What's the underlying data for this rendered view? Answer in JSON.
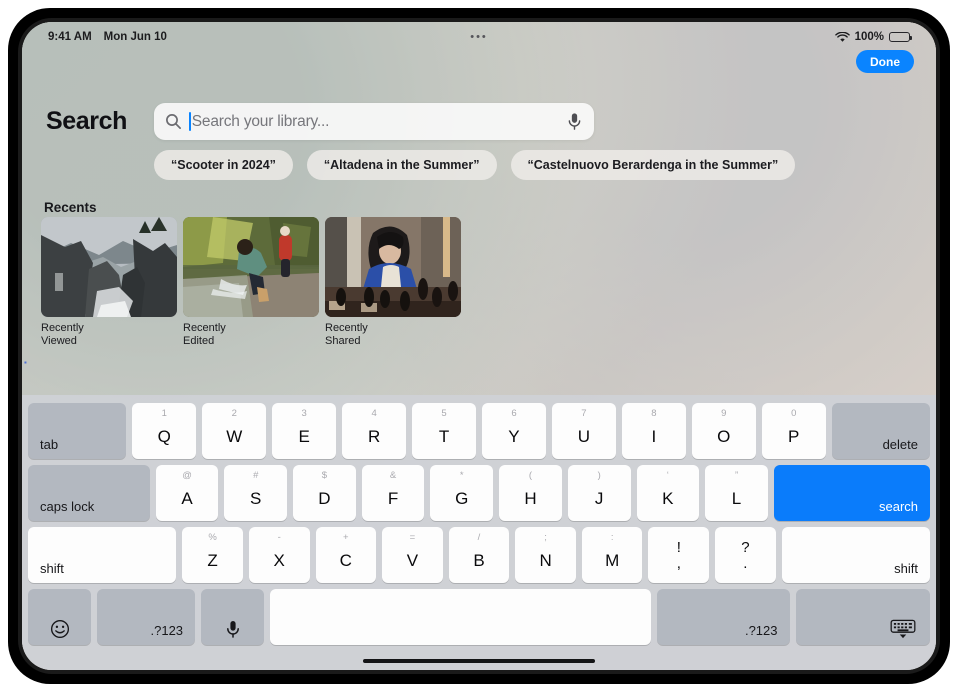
{
  "status_bar": {
    "time": "9:41 AM",
    "date": "Mon Jun 10",
    "battery_percent": "100%",
    "wifi_icon": "wifi-icon",
    "battery_icon": "battery-full-icon",
    "dynamic_island_dots": "•••"
  },
  "header": {
    "title": "Search",
    "done_label": "Done"
  },
  "search": {
    "placeholder": "Search your library...",
    "value": "",
    "search_icon": "search-icon",
    "mic_icon": "microphone-icon",
    "caret_color": "#0a84ff"
  },
  "suggestions": [
    {
      "label": "“Scooter in 2024”"
    },
    {
      "label": "“Altadena in the Summer”"
    },
    {
      "label": "“Castelnuovo Berardenga in the Summer”"
    }
  ],
  "recents": {
    "title": "Recents",
    "items": [
      {
        "label": "Recently Viewed",
        "description": "rocky coastal cove with cliffs and sea"
      },
      {
        "label": "Recently Edited",
        "description": "child splashing in a green creek"
      },
      {
        "label": "Recently Shared",
        "description": "person in blue shirt playing chess"
      }
    ]
  },
  "keyboard": {
    "row1": [
      {
        "main": "tab",
        "type": "mod"
      },
      {
        "main": "Q",
        "hint": "1"
      },
      {
        "main": "W",
        "hint": "2"
      },
      {
        "main": "E",
        "hint": "3"
      },
      {
        "main": "R",
        "hint": "4"
      },
      {
        "main": "T",
        "hint": "5"
      },
      {
        "main": "Y",
        "hint": "6"
      },
      {
        "main": "U",
        "hint": "7"
      },
      {
        "main": "I",
        "hint": "8"
      },
      {
        "main": "O",
        "hint": "9"
      },
      {
        "main": "P",
        "hint": "0"
      },
      {
        "main": "delete",
        "type": "mod-right"
      }
    ],
    "row2": [
      {
        "main": "caps lock",
        "type": "mod"
      },
      {
        "main": "A",
        "hint": "@"
      },
      {
        "main": "S",
        "hint": "#"
      },
      {
        "main": "D",
        "hint": "$"
      },
      {
        "main": "F",
        "hint": "&"
      },
      {
        "main": "G",
        "hint": "*"
      },
      {
        "main": "H",
        "hint": "("
      },
      {
        "main": "J",
        "hint": ")"
      },
      {
        "main": "K",
        "hint": "‘"
      },
      {
        "main": "L",
        "hint": "”"
      },
      {
        "main": "search",
        "type": "blue"
      }
    ],
    "row3": [
      {
        "main": "shift",
        "type": "light-mod"
      },
      {
        "main": "Z",
        "hint": "%"
      },
      {
        "main": "X",
        "hint": "-"
      },
      {
        "main": "C",
        "hint": "+"
      },
      {
        "main": "V",
        "hint": "="
      },
      {
        "main": "B",
        "hint": "/"
      },
      {
        "main": "N",
        "hint": ";"
      },
      {
        "main": "M",
        "hint": ":"
      },
      {
        "top": "!",
        "bottom": ",",
        "type": "dual"
      },
      {
        "top": "?",
        "bottom": ".",
        "type": "dual"
      },
      {
        "main": "shift",
        "type": "light-mod-right"
      }
    ],
    "row4": [
      {
        "icon": "emoji-smiley-icon",
        "type": "icon-left"
      },
      {
        "main": ".?123",
        "type": "mod-center"
      },
      {
        "icon": "microphone-icon",
        "type": "icon-center"
      },
      {
        "main": "",
        "type": "spacebar"
      },
      {
        "main": ".?123",
        "type": "mod-right-num"
      },
      {
        "icon": "hide-keyboard-icon",
        "type": "icon-right"
      }
    ]
  },
  "colors": {
    "accent_blue": "#0a84ff",
    "key_blue": "#0a7cfb",
    "keyboard_bg": "#ced1d6",
    "key_white": "#fdfdfd",
    "key_gray": "#b3b8c0"
  }
}
